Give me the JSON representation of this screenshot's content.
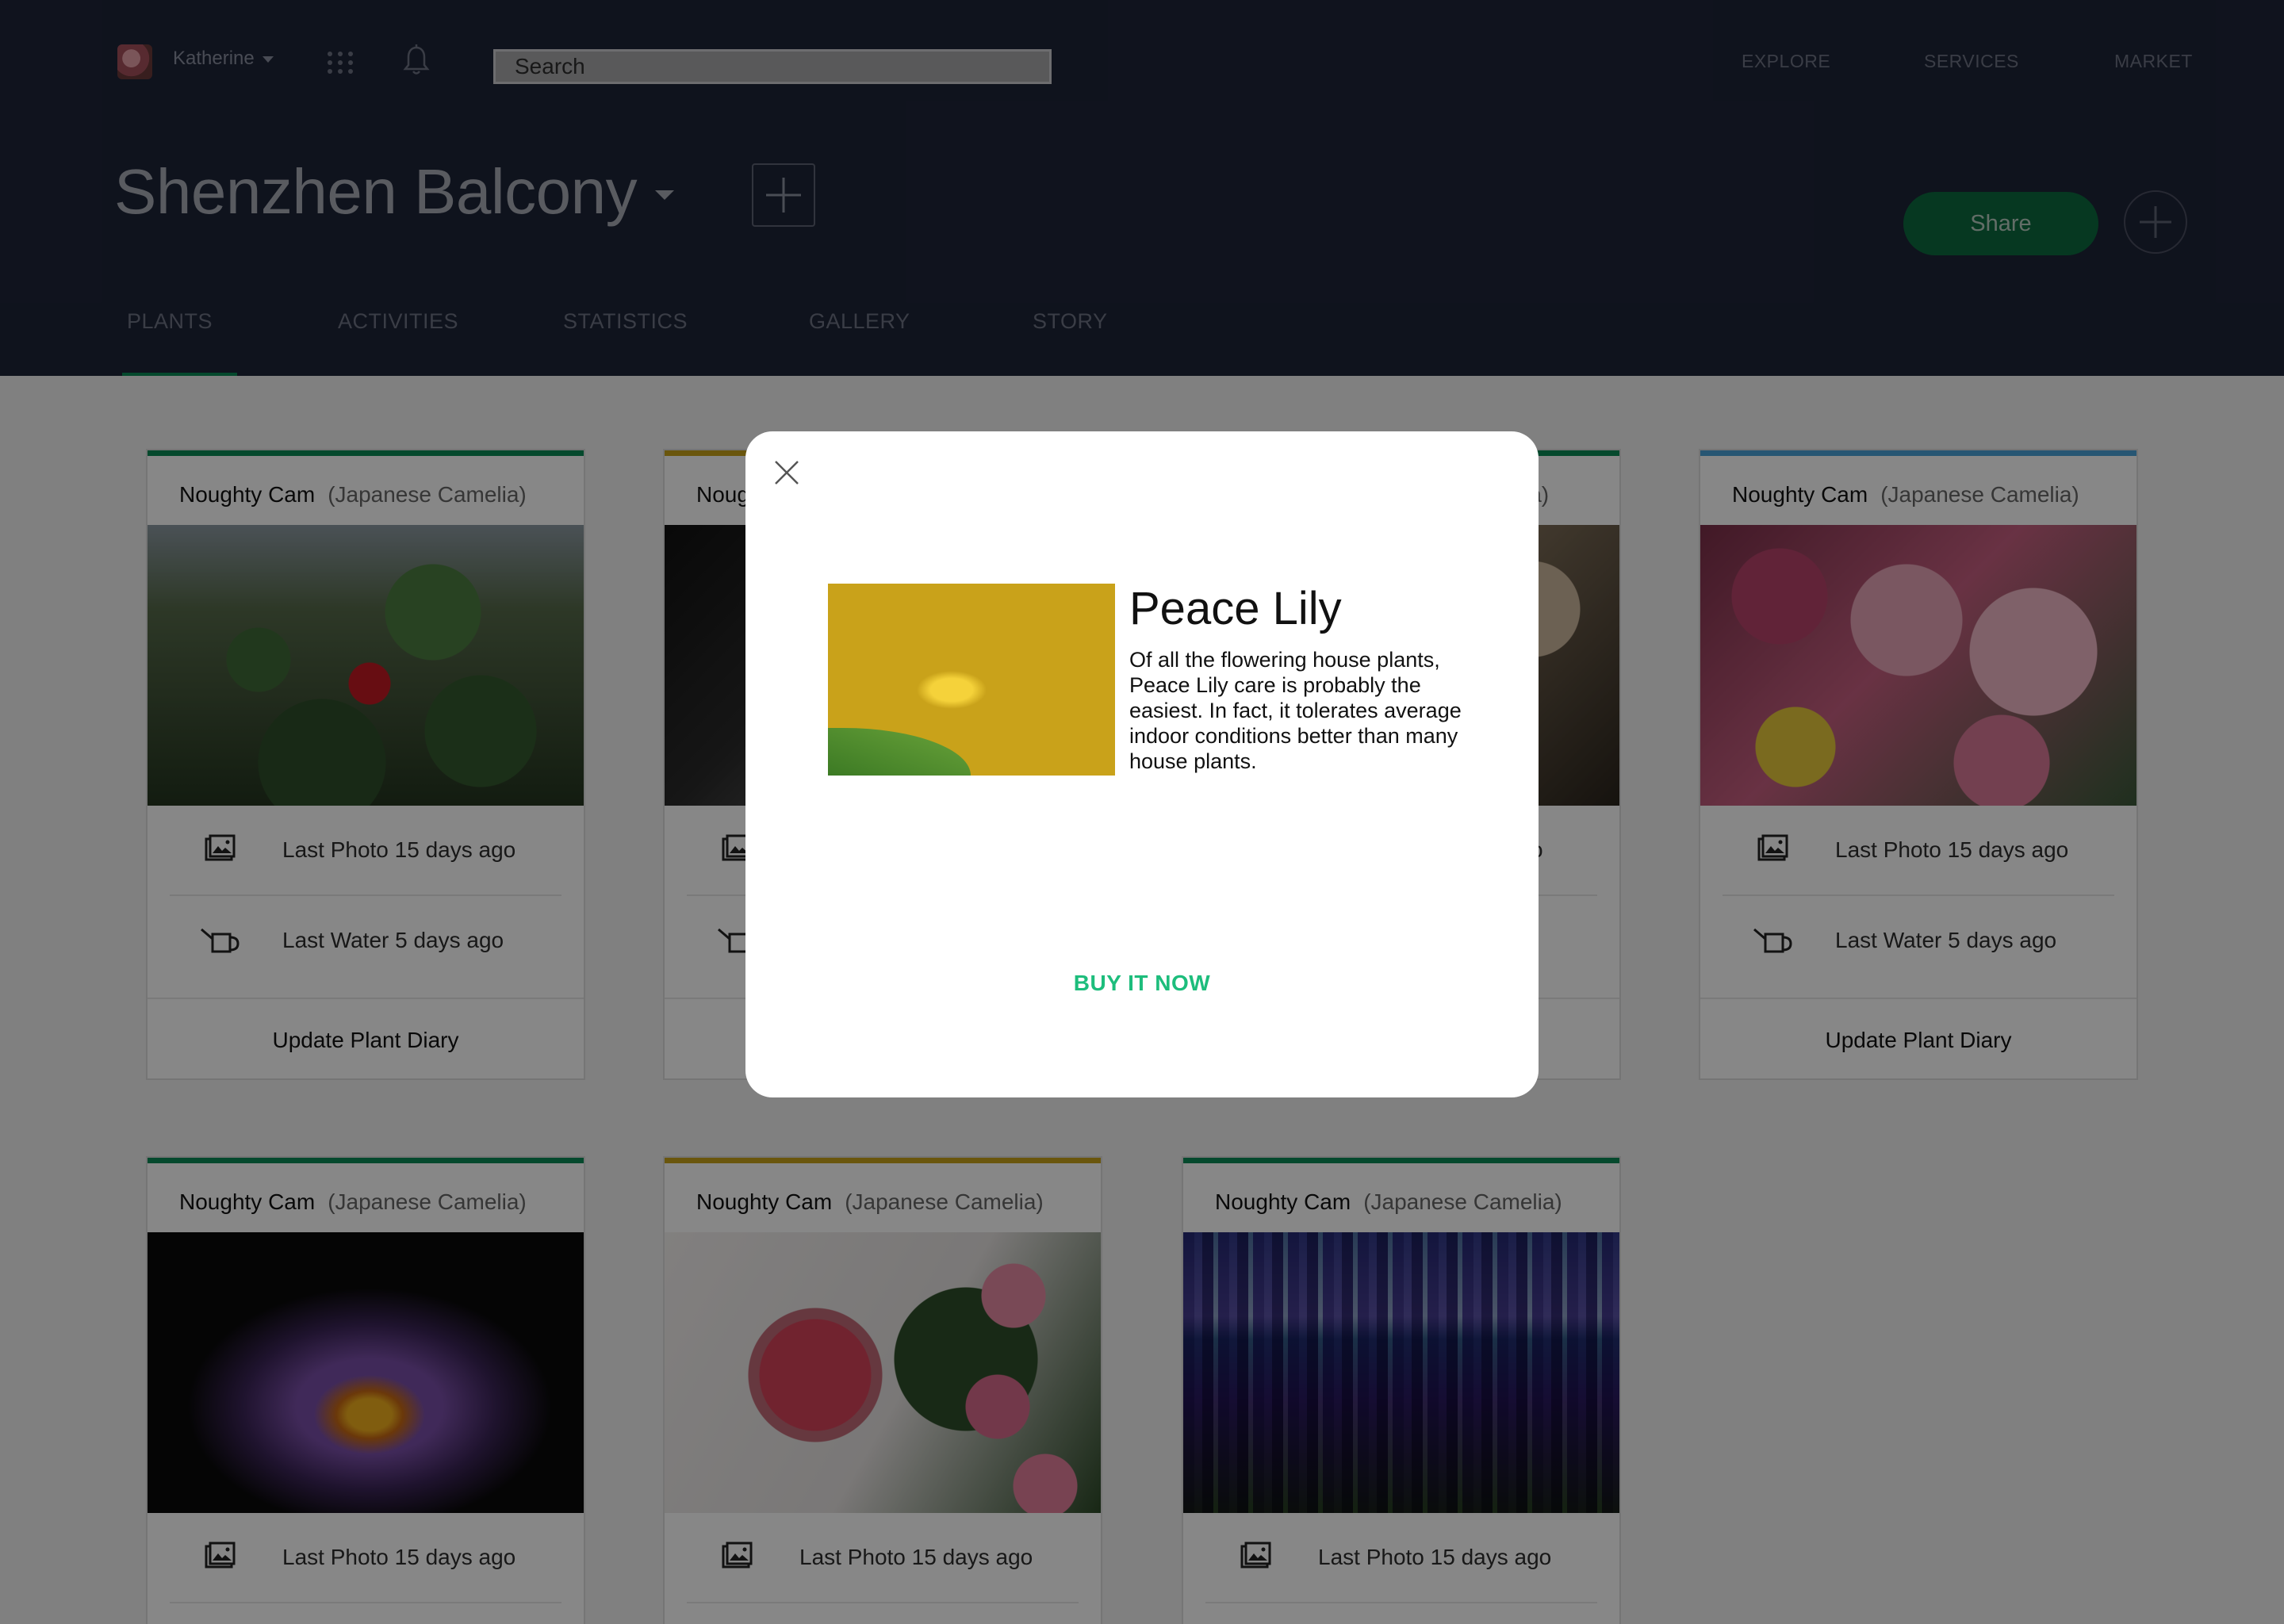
{
  "user": {
    "name": "Katherine"
  },
  "search": {
    "placeholder": "Search"
  },
  "topnav": [
    "EXPLORE",
    "SERVICES",
    "MARKET"
  ],
  "page": {
    "title": "Shenzhen Balcony",
    "share_label": "Share"
  },
  "tabs": [
    "PLANTS",
    "ACTIVITIES",
    "STATISTICS",
    "GALLERY",
    "STORY"
  ],
  "active_tab": "PLANTS",
  "colors": {
    "header_bg": "#1e2438",
    "accent_green": "#0a8a55",
    "card_green": "#0a8a55",
    "card_yellow": "#c9a31a",
    "card_blue": "#4aa3d9",
    "buy_green": "#1dbd7c"
  },
  "cards": [
    {
      "name": "Noughty Cam",
      "species": "(Japanese Camelia)",
      "accent": "green",
      "photo": "camellia",
      "last_photo": "Last Photo 15 days ago",
      "last_water": "Last Water 5 days ago",
      "action": "Update Plant Diary"
    },
    {
      "name": "Noug",
      "species": "",
      "accent": "yellow",
      "photo": "dark",
      "last_photo": "",
      "last_water": "",
      "action": ""
    },
    {
      "name": "",
      "species": "ia)",
      "accent": "green",
      "photo": "mushroom",
      "last_photo": "o",
      "last_water": "",
      "action": ""
    },
    {
      "name": "Noughty Cam",
      "species": "(Japanese Camelia)",
      "accent": "blue",
      "photo": "bouquet",
      "last_photo": "Last Photo 15 days ago",
      "last_water": "Last Water 5 days ago",
      "action": "Update Plant Diary"
    },
    {
      "name": "Noughty Cam",
      "species": "(Japanese Camelia)",
      "accent": "green",
      "photo": "lotus",
      "last_photo": "Last Photo 15 days ago"
    },
    {
      "name": "Noughty Cam",
      "species": "(Japanese Camelia)",
      "accent": "yellow",
      "photo": "smoothie",
      "last_photo": "Last Photo 15 days ago"
    },
    {
      "name": "Noughty Cam",
      "species": "(Japanese Camelia)",
      "accent": "green",
      "photo": "lupine",
      "last_photo": "Last Photo 15 days ago"
    }
  ],
  "modal": {
    "title": "Peace Lily",
    "description": "Of all the flowering house plants, Peace Lily care is probably the easiest. In fact, it tolerates average indoor conditions better than many house plants.",
    "cta": "BUY IT NOW"
  }
}
